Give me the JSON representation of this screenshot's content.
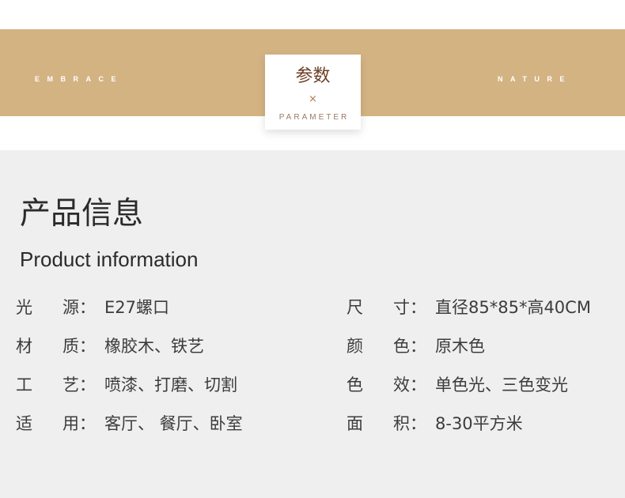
{
  "banner": {
    "left_text": "EMBRACE",
    "right_text": "NATURE",
    "badge_title": "参数",
    "badge_mark": "×",
    "badge_subtitle": "PARAMETER",
    "color": "#d4b383"
  },
  "info": {
    "title_cn": "产品信息",
    "title_en": "Product information",
    "left": [
      {
        "c1": "光",
        "c2": "源",
        "value": "E27螺口"
      },
      {
        "c1": "材",
        "c2": "质",
        "value": "橡胶木、铁艺"
      },
      {
        "c1": "工",
        "c2": "艺",
        "value": "喷漆、打磨、切割"
      },
      {
        "c1": "适",
        "c2": "用",
        "value": "客厅、 餐厅、卧室"
      }
    ],
    "right": [
      {
        "c1": "尺",
        "c2": "寸",
        "value": "直径85*85*高40CM"
      },
      {
        "c1": "颜",
        "c2": "色",
        "value": "原木色"
      },
      {
        "c1": "色",
        "c2": "效",
        "value": "单色光、三色变光"
      },
      {
        "c1": "面",
        "c2": "积",
        "value": " 8-30平方米"
      }
    ],
    "separator": "："
  }
}
